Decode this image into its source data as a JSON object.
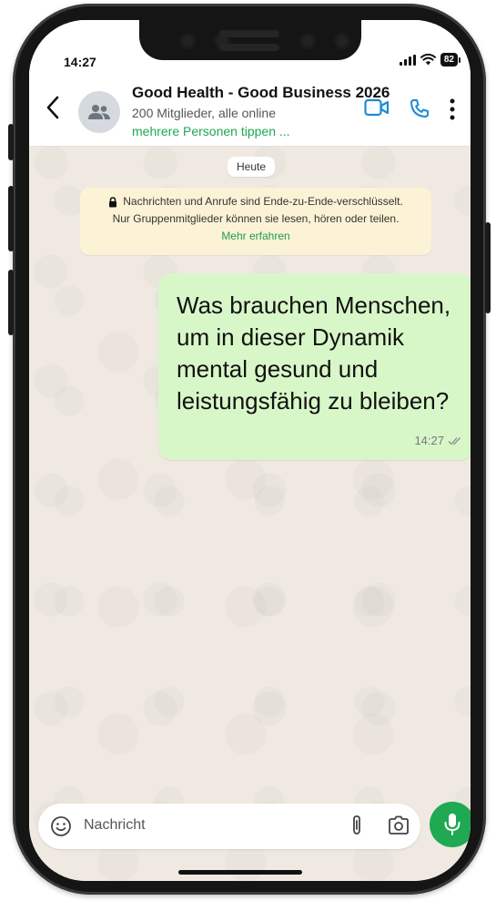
{
  "status_bar": {
    "time": "14:27",
    "battery": "82"
  },
  "chat_header": {
    "title": "Good Health - Good Business 2026",
    "subtitle": "200 Mitglieder, alle online",
    "typing": "mehrere Personen tippen ...",
    "icons": [
      "back-arrow-icon",
      "group-avatar-icon",
      "video-call-icon",
      "voice-call-icon",
      "more-options-icon"
    ]
  },
  "date_chip": "Heute",
  "encryption_notice": {
    "line1": "Nachrichten und Anrufe sind Ende-zu-Ende-verschlüsselt.",
    "line2": "Nur Gruppenmitglieder können sie lesen, hören oder teilen.",
    "link": "Mehr erfahren"
  },
  "messages": [
    {
      "text": "Was brauchen Menschen, um in dieser Dynamik mental gesund und leistungsfähig zu bleiben?",
      "time": "14:27",
      "status": "double-check-icon"
    }
  ],
  "composer": {
    "placeholder": "Nachricht",
    "icons": [
      "emoji-icon",
      "attach-icon",
      "camera-icon",
      "microphone-icon"
    ]
  },
  "colors": {
    "accent": "#1ea952",
    "outgoing_bubble": "#d8f7c8",
    "notice_bg": "#fcf3d6",
    "wallpaper": "#efe9e1"
  }
}
